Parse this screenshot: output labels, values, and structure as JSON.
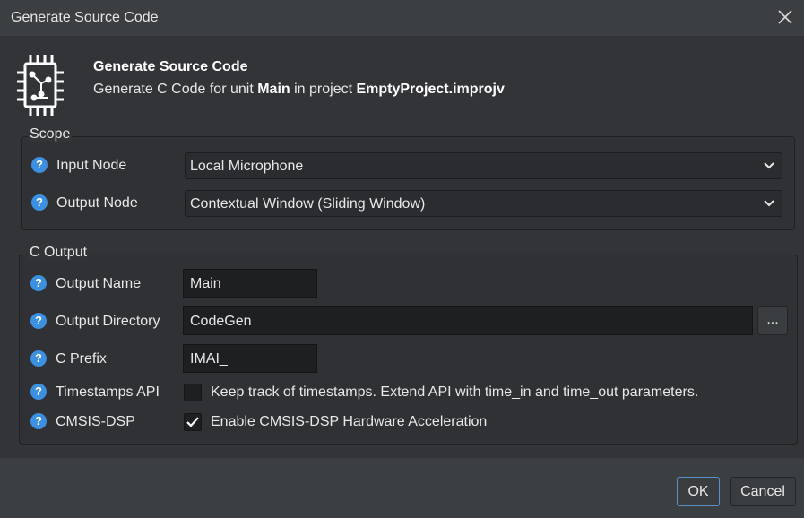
{
  "window": {
    "title": "Generate Source Code"
  },
  "header": {
    "icon": "circuit-chip-icon",
    "title": "Generate Source Code",
    "sub_prefix": "Generate C Code for unit ",
    "unit": "Main",
    "sub_middle": " in project ",
    "project": "EmptyProject.improjv"
  },
  "scope": {
    "label": "Scope",
    "input_node": {
      "label": "Input Node",
      "value": "Local Microphone"
    },
    "output_node": {
      "label": "Output Node",
      "value": "Contextual Window (Sliding Window)"
    }
  },
  "c_output": {
    "label": "C Output",
    "output_name": {
      "label": "Output Name",
      "value": "Main"
    },
    "output_directory": {
      "label": "Output Directory",
      "value": "CodeGen",
      "browse_label": "..."
    },
    "c_prefix": {
      "label": "C Prefix",
      "value": "IMAI_"
    },
    "timestamps_api": {
      "label": "Timestamps API",
      "checked": false,
      "text": "Keep track of timestamps. Extend API with time_in and time_out parameters."
    },
    "cmsis_dsp": {
      "label": "CMSIS-DSP",
      "checked": true,
      "text": "Enable CMSIS-DSP Hardware Acceleration"
    }
  },
  "footer": {
    "ok_label": "OK",
    "cancel_label": "Cancel"
  },
  "colors": {
    "help_icon": "#3d8fe0",
    "accent_border": "#5b8fc8"
  }
}
